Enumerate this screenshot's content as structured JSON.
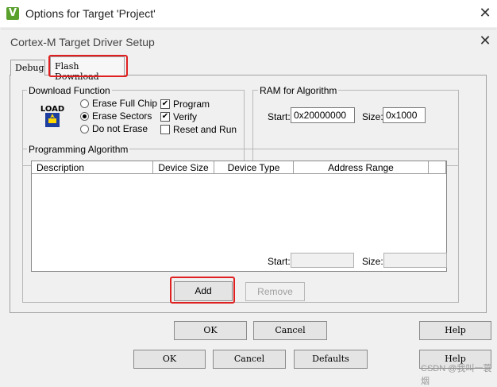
{
  "outer": {
    "title": "Options for Target 'Project'",
    "app_icon": "V",
    "close_glyph": "✕",
    "buttons": {
      "ok": "OK",
      "cancel": "Cancel",
      "defaults": "Defaults",
      "help": "Help"
    }
  },
  "inner": {
    "title": "Cortex-M Target Driver Setup",
    "close_glyph": "✕",
    "tabs": [
      {
        "label": "Debug",
        "active": false
      },
      {
        "label": "Flash Download",
        "active": true
      }
    ],
    "download_function": {
      "label": "Download Function",
      "icon_text": "LOAD",
      "erase_options": [
        {
          "label": "Erase Full Chip",
          "selected": false
        },
        {
          "label": "Erase Sectors",
          "selected": true
        },
        {
          "label": "Do not Erase",
          "selected": false
        }
      ],
      "checks": [
        {
          "label": "Program",
          "checked": true
        },
        {
          "label": "Verify",
          "checked": true
        },
        {
          "label": "Reset and Run",
          "checked": false
        }
      ]
    },
    "ram_for_algorithm": {
      "label": "RAM for Algorithm",
      "start_label": "Start:",
      "start_value": "0x20000000",
      "size_label": "Size:",
      "size_value": "0x1000"
    },
    "programming_algorithm": {
      "label": "Programming Algorithm",
      "columns": [
        "Description",
        "Device Size",
        "Device Type",
        "Address Range"
      ],
      "rows": [],
      "start_label": "Start:",
      "start_value": "",
      "size_label": "Size:",
      "size_value": ""
    },
    "add_label": "Add",
    "remove_label": "Remove",
    "buttons": {
      "ok": "OK",
      "cancel": "Cancel",
      "help": "Help"
    },
    "check_glyph": "✔"
  },
  "watermark": "CSDN @我叫一蓑烟"
}
